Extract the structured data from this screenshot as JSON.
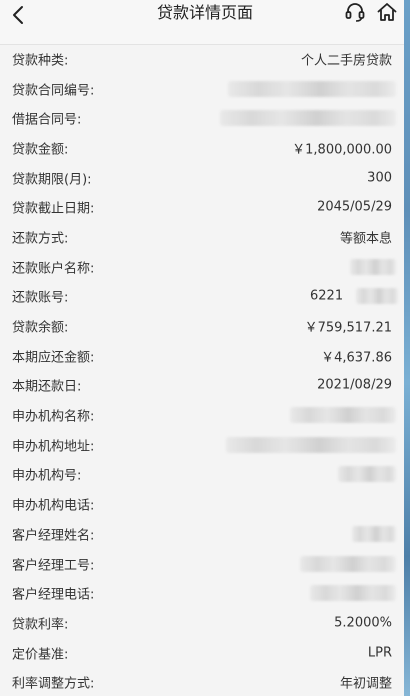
{
  "header": {
    "title": "贷款详情页面"
  },
  "icons": {
    "back": "chevron-left-icon",
    "service": "headset-icon",
    "home": "home-icon"
  },
  "fields": {
    "loan_type": {
      "label": "贷款种类:",
      "value": "个人二手房贷款"
    },
    "loan_contract_no": {
      "label": "贷款合同编号:"
    },
    "borrow_contract_no": {
      "label": "借据合同号:"
    },
    "loan_amount": {
      "label": "贷款金额:",
      "value": "￥1,800,000.00"
    },
    "loan_term": {
      "label": "贷款期限(月):",
      "value": "300"
    },
    "loan_end_date": {
      "label": "贷款截止日期:",
      "value": "2045/05/29"
    },
    "repay_method": {
      "label": "还款方式:",
      "value": "等额本息"
    },
    "repay_account_name": {
      "label": "还款账户名称:"
    },
    "repay_account_no": {
      "label": "还款账号:",
      "value_prefix": "6221"
    },
    "loan_balance": {
      "label": "贷款余额:",
      "value": "￥759,517.21"
    },
    "current_due": {
      "label": "本期应还金额:",
      "value": "￥4,637.86"
    },
    "current_repay_date": {
      "label": "本期还款日:",
      "value": "2021/08/29"
    },
    "branch_name": {
      "label": "申办机构名称:"
    },
    "branch_address": {
      "label": "申办机构地址:"
    },
    "branch_no": {
      "label": "申办机构号:"
    },
    "branch_phone": {
      "label": "申办机构电话:"
    },
    "manager_name": {
      "label": "客户经理姓名:"
    },
    "manager_id": {
      "label": "客户经理工号:"
    },
    "manager_phone": {
      "label": "客户经理电话:"
    },
    "interest_rate": {
      "label": "贷款利率:",
      "value": "5.2000%"
    },
    "pricing_base": {
      "label": "定价基准:",
      "value": "LPR"
    },
    "rate_adjust": {
      "label": "利率调整方式:",
      "value": "年初调整"
    }
  },
  "colors": {
    "background": "#f4f4f4",
    "header_bg": "#f7f7f7",
    "text": "#333333"
  }
}
